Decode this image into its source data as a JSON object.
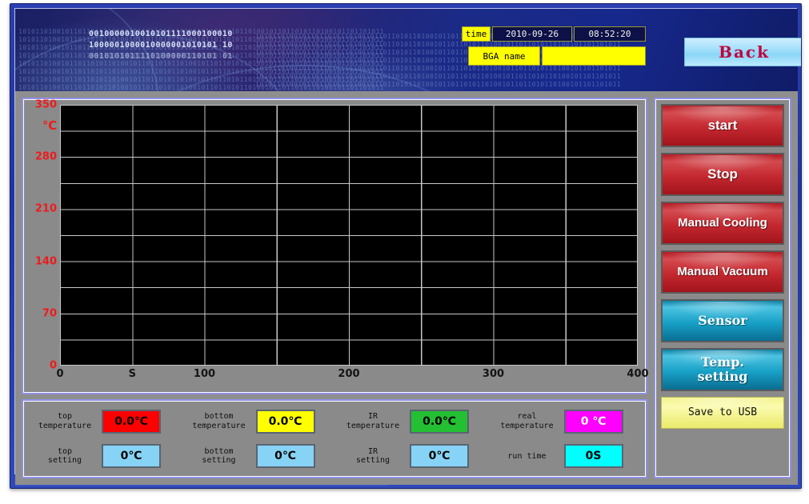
{
  "header": {
    "binary_lines": [
      "0010000010010101111000100010",
      "1000001000010000001010101 10",
      "0010101011110100000110101 01"
    ],
    "bg_bits": "10101101001011011010110100101101101011010010110110101101001011011010110100101101101011"
  },
  "info": {
    "time_label": "time",
    "date_value": "2010-09-26",
    "clock_value": "08:52:20",
    "bga_label": "BGA name",
    "bga_value": ""
  },
  "back_button": {
    "label": "Back"
  },
  "chart_data": {
    "type": "line",
    "title": "",
    "xlabel": "S",
    "ylabel": "℃",
    "series": [],
    "x": [],
    "xlim": [
      0,
      400
    ],
    "ylim": [
      0,
      350
    ],
    "x_ticks": [
      {
        "label": "0",
        "value": 0
      },
      {
        "label": "S",
        "value": 25
      },
      {
        "label": "100",
        "value": 100
      },
      {
        "label": "200",
        "value": 200
      },
      {
        "label": "300",
        "value": 300
      },
      {
        "label": "400",
        "value": 400
      }
    ],
    "y_ticks": [
      {
        "label": "0",
        "value": 0
      },
      {
        "label": "70",
        "value": 70
      },
      {
        "label": "140",
        "value": 140
      },
      {
        "label": "210",
        "value": 210
      },
      {
        "label": "280",
        "value": 280
      },
      {
        "label": "350",
        "value": 350
      }
    ],
    "y_unit": "℃",
    "grid": true,
    "grid_cols": 8,
    "grid_rows": 10,
    "legend": "none",
    "plot_background": "#000000",
    "grid_color": "#c8c8c8",
    "y_tick_color": "#ee1b1b",
    "x_tick_color": "#141414"
  },
  "readouts": [
    {
      "label": "top\ntemperature",
      "value": "0.0℃",
      "bg": "#ff0000",
      "fg": "#000000"
    },
    {
      "label": "bottom\ntemperature",
      "value": "0.0℃",
      "bg": "#ffff00",
      "fg": "#000000"
    },
    {
      "label": "IR\ntemperature",
      "value": "0.0℃",
      "bg": "#22c032",
      "fg": "#000000"
    },
    {
      "label": "real\ntemperature",
      "value": "0 ℃",
      "bg": "#ff00ff",
      "fg": "#ffffff"
    },
    {
      "label": "top\nsetting",
      "value": "0℃",
      "bg": "#87d3f5",
      "fg": "#000000"
    },
    {
      "label": "bottom\nsetting",
      "value": "0℃",
      "bg": "#87d3f5",
      "fg": "#000000"
    },
    {
      "label": "IR\nsetting",
      "value": "0℃",
      "bg": "#87d3f5",
      "fg": "#000000"
    },
    {
      "label": "run time",
      "value": "0S",
      "bg": "#00ffff",
      "fg": "#000000"
    }
  ],
  "buttons": [
    {
      "label": "start",
      "style": "red"
    },
    {
      "label": "Stop",
      "style": "red"
    },
    {
      "label": "Manual Cooling",
      "style": "red-small"
    },
    {
      "label": "Manual Vacuum",
      "style": "red-small"
    },
    {
      "label": "Sensor",
      "style": "teal"
    },
    {
      "label": "Temp.\nsetting",
      "style": "teal"
    },
    {
      "label": "Save to USB",
      "style": "yellow"
    }
  ]
}
